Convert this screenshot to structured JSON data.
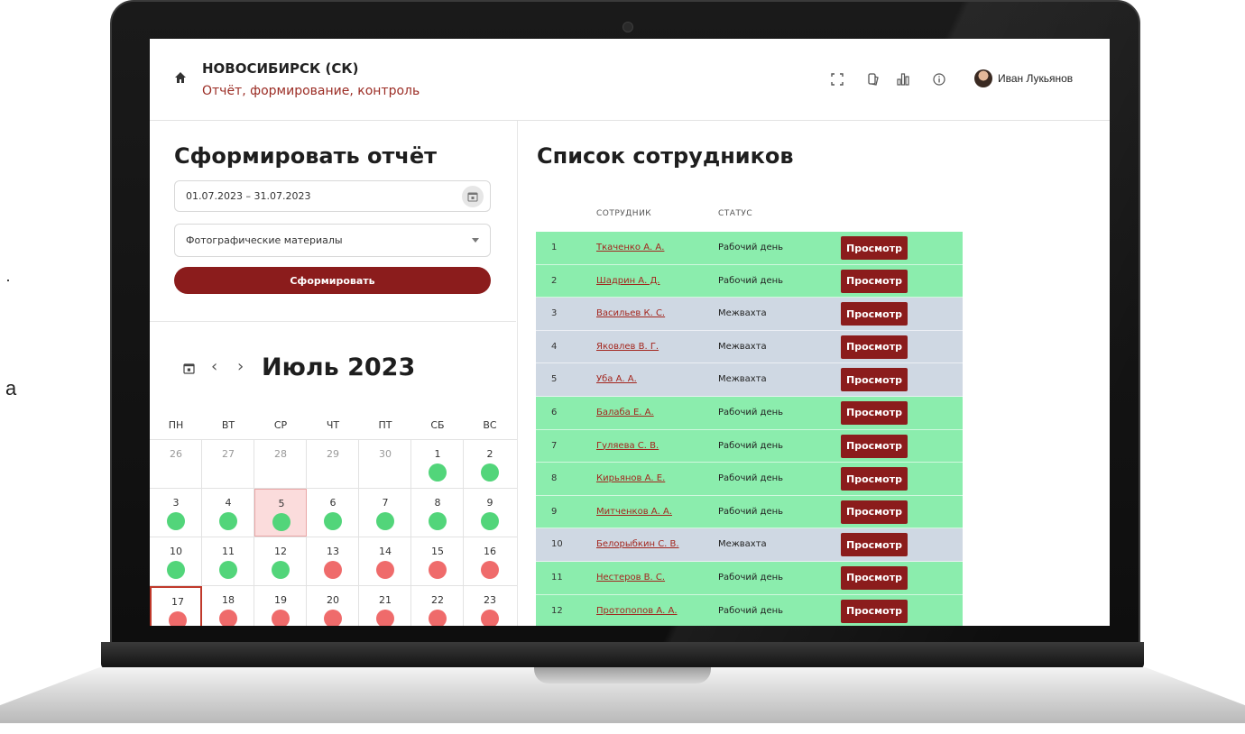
{
  "header": {
    "title": "НОВОСИБИРСК (СК)",
    "subtitle": "Отчёт, формирование, контроль",
    "icons": [
      "home-icon",
      "fullscreen-icon",
      "documents-icon",
      "stats-icon",
      "info-icon"
    ],
    "user_name": "Иван Лукьянов"
  },
  "report": {
    "title": "Сформировать отчёт",
    "date_range": "01.07.2023 – 31.07.2023",
    "report_type": "Фотографические материалы",
    "submit_label": "Сформировать"
  },
  "calendar": {
    "month_label": "Июль 2023",
    "weekdays": [
      "ПН",
      "ВТ",
      "СР",
      "ЧТ",
      "ПТ",
      "СБ",
      "ВС"
    ],
    "weeks": [
      [
        {
          "d": "26",
          "m": true
        },
        {
          "d": "27",
          "m": true
        },
        {
          "d": "28",
          "m": true
        },
        {
          "d": "29",
          "m": true
        },
        {
          "d": "30",
          "m": true
        },
        {
          "d": "1",
          "s": "ok"
        },
        {
          "d": "2",
          "s": "ok"
        }
      ],
      [
        {
          "d": "3",
          "s": "ok"
        },
        {
          "d": "4",
          "s": "ok"
        },
        {
          "d": "5",
          "s": "ok",
          "today": true
        },
        {
          "d": "6",
          "s": "ok"
        },
        {
          "d": "7",
          "s": "ok"
        },
        {
          "d": "8",
          "s": "ok"
        },
        {
          "d": "9",
          "s": "ok"
        }
      ],
      [
        {
          "d": "10",
          "s": "ok"
        },
        {
          "d": "11",
          "s": "ok"
        },
        {
          "d": "12",
          "s": "ok"
        },
        {
          "d": "13",
          "s": "bad"
        },
        {
          "d": "14",
          "s": "bad"
        },
        {
          "d": "15",
          "s": "bad"
        },
        {
          "d": "16",
          "s": "bad"
        }
      ],
      [
        {
          "d": "17",
          "s": "bad",
          "selected": true
        },
        {
          "d": "18",
          "s": "bad"
        },
        {
          "d": "19",
          "s": "bad"
        },
        {
          "d": "20",
          "s": "bad"
        },
        {
          "d": "21",
          "s": "bad"
        },
        {
          "d": "22",
          "s": "bad"
        },
        {
          "d": "23",
          "s": "bad"
        }
      ]
    ]
  },
  "employees": {
    "title": "Список сотрудников",
    "columns": {
      "employee": "СОТРУДНИК",
      "status": "СТАТУС"
    },
    "view_label": "Просмотр",
    "rows": [
      {
        "n": "1",
        "name": "Ткаченко А. А.",
        "status": "Рабочий день",
        "type": "work"
      },
      {
        "n": "2",
        "name": "Шадрин А. Д.",
        "status": "Рабочий день",
        "type": "work"
      },
      {
        "n": "3",
        "name": "Васильев К. С.",
        "status": "Межвахта",
        "type": "rest"
      },
      {
        "n": "4",
        "name": "Яковлев В. Г.",
        "status": "Межвахта",
        "type": "rest"
      },
      {
        "n": "5",
        "name": "Уба А. А.",
        "status": "Межвахта",
        "type": "rest"
      },
      {
        "n": "6",
        "name": "Балаба Е. А.",
        "status": "Рабочий день",
        "type": "work"
      },
      {
        "n": "7",
        "name": "Гуляева С. В.",
        "status": "Рабочий день",
        "type": "work"
      },
      {
        "n": "8",
        "name": "Кирьянов А. Е.",
        "status": "Рабочий день",
        "type": "work"
      },
      {
        "n": "9",
        "name": "Митченков А. А.",
        "status": "Рабочий день",
        "type": "work"
      },
      {
        "n": "10",
        "name": "Белорыбкин С. В.",
        "status": "Межвахта",
        "type": "rest"
      },
      {
        "n": "11",
        "name": "Нестеров В. С.",
        "status": "Рабочий день",
        "type": "work"
      },
      {
        "n": "12",
        "name": "Протопопов А. А.",
        "status": "Рабочий день",
        "type": "work"
      }
    ]
  },
  "colors": {
    "accent": "#8b1c1c",
    "work_row": "#8bedad",
    "rest_row": "#cfd8e3",
    "ok_dot": "#52d57a",
    "bad_dot": "#ef6b6b"
  },
  "stray_text": {
    "dot": "·",
    "letter": "а"
  }
}
